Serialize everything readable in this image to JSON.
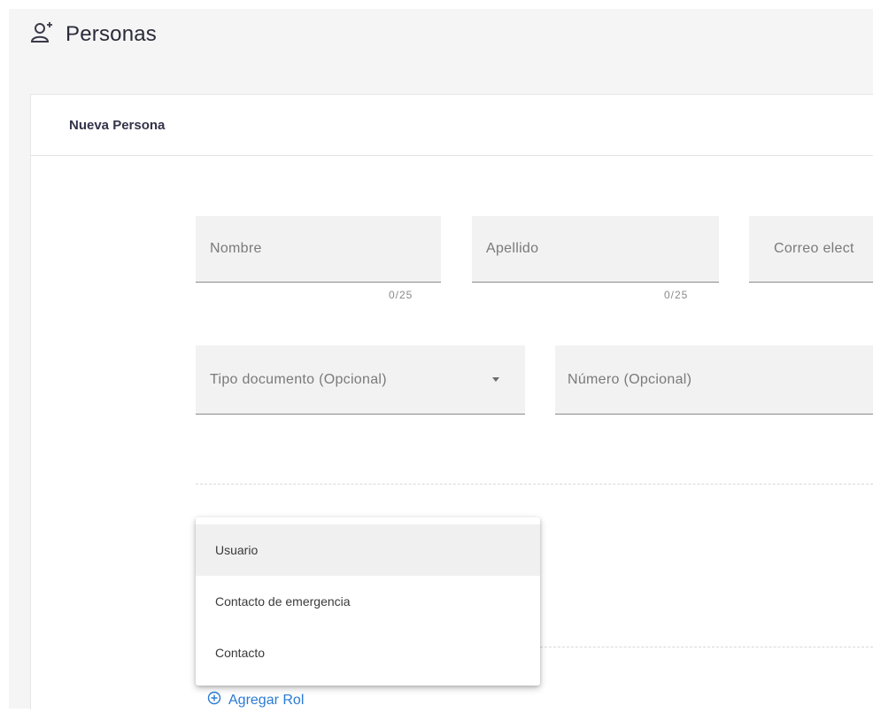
{
  "header": {
    "title": "Personas",
    "icon": "add-person-icon"
  },
  "card": {
    "title": "Nueva Persona"
  },
  "form": {
    "nombre": {
      "label": "Nombre",
      "counter": "0/25"
    },
    "apellido": {
      "label": "Apellido",
      "counter": "0/25"
    },
    "correo": {
      "label": "Correo elect"
    },
    "tipo_documento": {
      "label": "Tipo documento (Opcional)"
    },
    "numero": {
      "label": "Número (Opcional)"
    }
  },
  "role_menu": {
    "items": [
      {
        "label": "Usuario",
        "highlighted": true
      },
      {
        "label": "Contacto de emergencia",
        "highlighted": false
      },
      {
        "label": "Contacto",
        "highlighted": false
      }
    ]
  },
  "add_role": {
    "label": "Agregar Rol",
    "color": "#2a7bd4",
    "icon": "plus-circle-icon"
  }
}
